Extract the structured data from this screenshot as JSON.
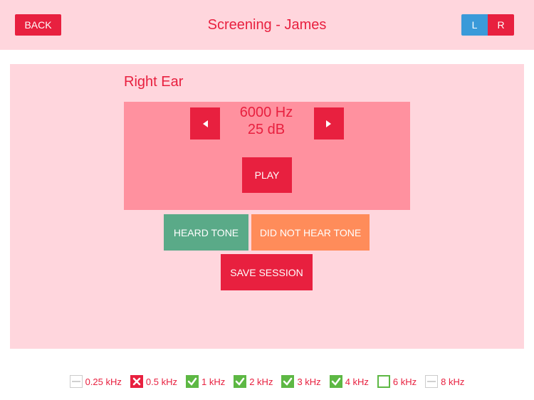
{
  "header": {
    "back_label": "BACK",
    "title": "Screening - James",
    "ear_left_label": "L",
    "ear_right_label": "R"
  },
  "main": {
    "ear_label": "Right Ear",
    "frequency_text": "6000 Hz",
    "level_text": "25 dB",
    "play_label": "PLAY",
    "heard_label": "HEARD TONE",
    "not_heard_label": "DID NOT HEAR TONE",
    "save_label": "SAVE SESSION"
  },
  "frequencies": [
    {
      "label": "0.25 kHz",
      "status": "untested"
    },
    {
      "label": "0.5 kHz",
      "status": "fail"
    },
    {
      "label": "1 kHz",
      "status": "pass"
    },
    {
      "label": "2 kHz",
      "status": "pass"
    },
    {
      "label": "3 kHz",
      "status": "pass"
    },
    {
      "label": "4 kHz",
      "status": "pass"
    },
    {
      "label": "6 kHz",
      "status": "empty"
    },
    {
      "label": "8 kHz",
      "status": "untested"
    }
  ],
  "colors": {
    "accent": "#e8203f",
    "pink_bg": "#ffd6dd",
    "tone_box": "#ff919f",
    "heard": "#5aaa88",
    "not_heard": "#ff8c5a",
    "pass": "#5db844",
    "selected_ear_left": "#3a9ad9"
  }
}
